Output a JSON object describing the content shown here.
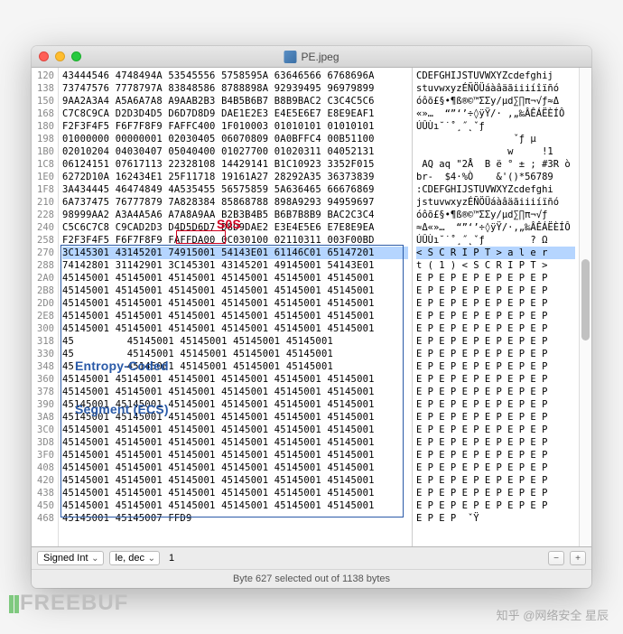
{
  "window": {
    "title": "PE.jpeg"
  },
  "annotations": {
    "sos_label": "S0S",
    "ecs_label_line1": "Entropy-Coded",
    "ecs_label_line2": "Segment (ECS)"
  },
  "offsets": [
    "120",
    "138",
    "150",
    "168",
    "180",
    "198",
    "1B0",
    "1C8",
    "1E0",
    "1F8",
    "210",
    "228",
    "240",
    "258",
    "270",
    "288",
    "2A0",
    "2B8",
    "2D0",
    "2E8",
    "300",
    "318",
    "330",
    "348",
    "360",
    "378",
    "390",
    "3A8",
    "3C0",
    "3D8",
    "3F0",
    "408",
    "420",
    "438",
    "450",
    "468"
  ],
  "hex_rows": [
    "43444546 4748494A 53545556 5758595A 63646566 6768696A",
    "73747576 7778797A 83848586 8788898A 92939495 96979899",
    "9AA2A3A4 A5A6A7A8 A9AAB2B3 B4B5B6B7 B8B9BAC2 C3C4C5C6",
    "C7C8C9CA D2D3D4D5 D6D7D8D9 DAE1E2E3 E4E5E6E7 E8E9EAF1",
    "F2F3F4F5 F6F7F8F9 FAFFC400 1F010003 01010101 01010101",
    "01000000 00000001 02030405 06070809 0A0BFFC4 00B51100",
    "02010204 04030407 05040400 01027700 01020311 04052131",
    "06124151 07617113 22328108 14429141 B1C10923 3352F015",
    "6272D10A 162434E1 25F11718 19161A27 28292A35 36373839",
    "3A434445 46474849 4A535455 56575859 5A636465 66676869",
    "6A737475 76777879 7A828384 85868788 898A9293 94959697",
    "98999AA2 A3A4A5A6 A7A8A9AA B2B3B4B5 B6B7B8B9 BAC2C3C4",
    "C5C6C7C8 C9CAD2D3 D4D5D6D7 D8D9DAE2 E3E4E5E6 E7E8E9EA",
    "F2F3F4F5 F6F7F8F9 FAFFDA00 0C030100 02110311 003F00BD",
    "3C145301 43145201 74915001 54143E01 61146C01 65147201",
    "74142801 31142901 3C145301 43145201 49145001 54143E01",
    "45145001 45145001 45145001 45145001 45145001 45145001",
    "45145001 45145001 45145001 45145001 45145001 45145001",
    "45145001 45145001 45145001 45145001 45145001 45145001",
    "45145001 45145001 45145001 45145001 45145001 45145001",
    "45145001 45145001 45145001 45145001 45145001 45145001",
    "45         45145001 45145001 45145001 45145001",
    "45         45145001 45145001 45145001 45145001",
    "45         45145001 45145001 45145001 45145001",
    "45145001 45145001 45145001 45145001 45145001 45145001",
    "45145001 45145001 45145001 45145001 45145001 45145001",
    "45145001 45145001 45145001 45145001 45145001 45145001",
    "45145001 45145001 45145001 45145001 45145001 45145001",
    "45145001 45145001 45145001 45145001 45145001 45145001",
    "45145001 45145001 45145001 45145001 45145001 45145001",
    "45145001 45145001 45145001 45145001 45145001 45145001",
    "45145001 45145001 45145001 45145001 45145001 45145001",
    "45145001 45145001 45145001 45145001 45145001 45145001",
    "45145001 45145001 45145001 45145001 45145001 45145001",
    "45145001 45145001 45145001 45145001 45145001 45145001",
    "45145001 45145007 FFD9"
  ],
  "ascii_rows": [
    "CDEFGHIJSTUVWXYZcdefghij",
    "stuvwxyzÉÑÖÜáàâäãiiiíîïñó",
    "óôõ£§•¶ß®©™ΣΣy/µd∑∏π¬√ƒ≈Δ",
    "«»…  “”‘’÷◊ÿŸ/· ‚„‰ÂÊÁËÈÍÔ",
    "ÚÛÙı˘˙˚¸˝˛ˇƒ",
    "                 ˇƒ µ",
    "                w     !1",
    " AQ aq \"2Å  B ë ° ± ; #3R ò",
    "br-  $4·%Ò    &'()*56789",
    ":CDEFGHIJSTUVWXYZcdefghi",
    "jstuvwxyzÉÑÖÜáàâäãiiiíïñó",
    "óôõ£§•¶ß®©™ΣΣy/µd∑∏π¬√ƒ",
    "≈Δ«»…  “”‘’÷◊ÿŸ/·‚„‰ÂÊÁËÈÍÔ",
    "ÚÛÙı˘˙˚¸˝˛ˇƒ        ? Ω",
    "< S C R I P T > a l e r",
    "t ( 1 ) < S C R I P T >",
    "E P E P E P E P E P E P",
    "E P E P E P E P E P E P",
    "E P E P E P E P E P E P",
    "E P E P E P E P E P E P",
    "E P E P E P E P E P E P",
    "E P E P E P E P E P E P",
    "E P E P E P E P E P E P",
    "E P E P E P E P E P E P",
    "E P E P E P E P E P E P",
    "E P E P E P E P E P E P",
    "E P E P E P E P E P E P",
    "E P E P E P E P E P E P",
    "E P E P E P E P E P E P",
    "E P E P E P E P E P E P",
    "E P E P E P E P E P E P",
    "E P E P E P E P E P E P",
    "E P E P E P E P E P E P",
    "E P E P E P E P E P E P",
    "E P E P E P E P E P E P",
    "E P E P  ˇŸ"
  ],
  "controls": {
    "type_select": "Signed Int",
    "endian_select": "le, dec",
    "value": "1",
    "minus": "−",
    "plus": "+"
  },
  "status": "Byte 627 selected out of 1138 bytes",
  "watermarks": {
    "logo": "FREEBUF",
    "zhihu": "知乎 @网络安全 星辰"
  }
}
